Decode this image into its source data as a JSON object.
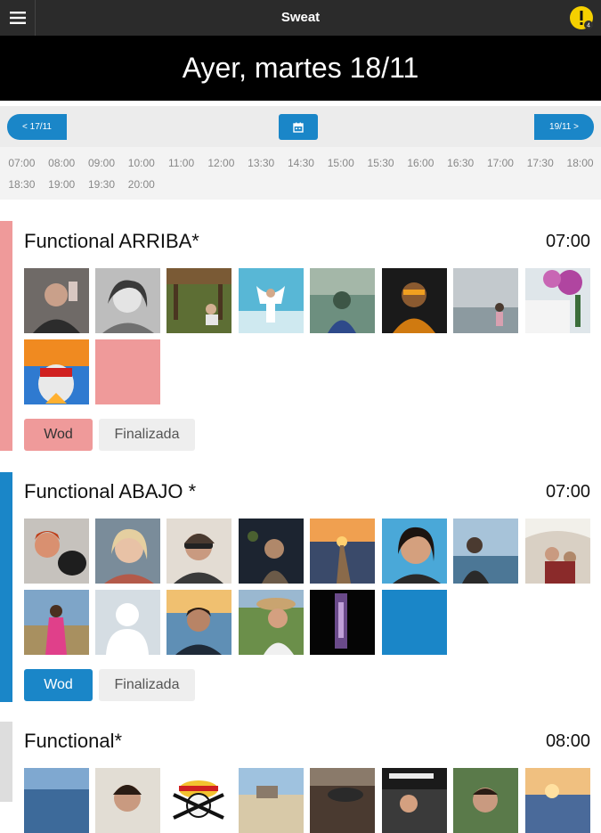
{
  "header": {
    "title": "Sweat",
    "alert_badge": "4"
  },
  "date_banner": "Ayer, martes 18/11",
  "day_nav": {
    "prev": "< 17/11",
    "next": "19/11 >",
    "calendar_icon": "calendar-icon"
  },
  "times": [
    "07:00",
    "08:00",
    "09:00",
    "10:00",
    "11:00",
    "12:00",
    "13:30",
    "14:30",
    "15:00",
    "15:30",
    "16:00",
    "16:30",
    "17:00",
    "17:30",
    "18:00",
    "18:30",
    "19:00",
    "19:30",
    "20:00"
  ],
  "colors": {
    "arriba": "#ef9a9a",
    "abajo": "#1a86c8",
    "functional": "#dddddd",
    "topbar": "#2b2b2b",
    "banner": "#000000",
    "alert": "#f5d000"
  },
  "classes": [
    {
      "title": "Functional ARRIBA*",
      "time": "07:00",
      "wod_label": "Wod",
      "finalizada_label": "Finalizada"
    },
    {
      "title": "Functional ABAJO *",
      "time": "07:00",
      "wod_label": "Wod",
      "finalizada_label": "Finalizada"
    },
    {
      "title": "Functional*",
      "time": "08:00"
    }
  ]
}
